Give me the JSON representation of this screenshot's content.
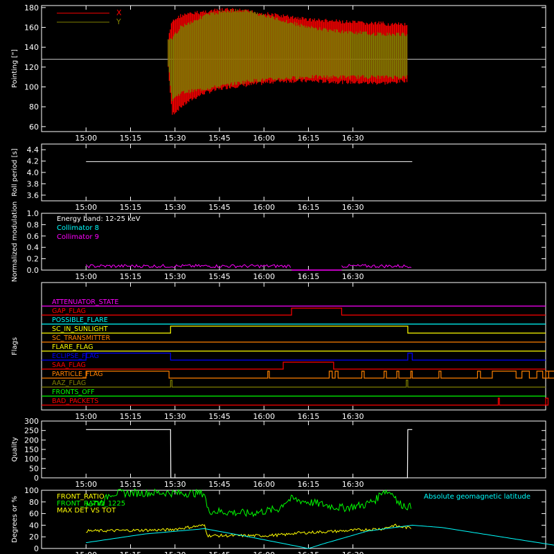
{
  "x_ticks": [
    "15:00",
    "15:15",
    "15:30",
    "15:45",
    "16:00",
    "16:15",
    "16:30"
  ],
  "colors": {
    "background": "#000000",
    "axes": "#ffffff",
    "x": "#ff0000",
    "y": "#808000",
    "cyan": "#00ffff",
    "magenta": "#ff00ff",
    "yellow": "#ffff00",
    "green": "#00ff00",
    "orange": "#ff8000",
    "blue": "#0000ff"
  },
  "chart_data": [
    {
      "type": "line",
      "ylabel": "Pointing [\"]",
      "ylim": [
        55,
        182
      ],
      "yticks": [
        60,
        80,
        100,
        120,
        140,
        160,
        180
      ],
      "xlim_min": [
        0,
        110
      ],
      "legend_position": "top-left",
      "reference_line": 128,
      "series": [
        {
          "name": "X",
          "color": "#ff0000",
          "t": [
            27.7,
            29,
            32,
            36,
            40,
            48,
            55,
            65,
            75,
            85,
            95,
            100,
            103,
            108.5
          ],
          "upper": [
            150,
            168,
            174,
            176,
            178,
            180,
            178,
            174,
            170,
            168,
            166,
            166,
            165,
            165
          ],
          "lower": [
            118,
            70,
            78,
            86,
            92,
            98,
            100,
            104,
            104,
            103,
            102,
            102,
            102,
            105
          ]
        },
        {
          "name": "Y",
          "color": "#808000",
          "t": [
            27.7,
            29,
            32,
            36,
            40,
            48,
            55,
            65,
            75,
            85,
            95,
            100,
            103,
            108.5
          ],
          "upper": [
            148,
            150,
            163,
            168,
            174,
            179,
            178,
            170,
            162,
            158,
            156,
            155,
            155,
            155
          ],
          "lower": [
            120,
            85,
            92,
            94,
            96,
            100,
            104,
            106,
            108,
            108,
            108,
            108,
            108,
            108
          ]
        }
      ]
    },
    {
      "type": "line",
      "ylabel": "Roll period [s]",
      "ylim": [
        3.5,
        4.5
      ],
      "yticks": [
        3.6,
        3.8,
        4.0,
        4.2,
        4.4
      ],
      "ytick_labels": [
        "3.6",
        "3.8",
        "4.0",
        "4.2",
        "4.4"
      ],
      "series": [
        {
          "name": "",
          "color": "#ffffff",
          "t": [
            0,
            110
          ],
          "values": [
            4.19,
            4.19
          ]
        }
      ]
    },
    {
      "type": "line",
      "ylabel": "Normalized modulation",
      "ylim": [
        0,
        1
      ],
      "yticks": [
        0,
        0.2,
        0.4,
        0.6,
        0.8,
        1.0
      ],
      "ytick_labels": [
        "0.0",
        "0.2",
        "0.4",
        "0.6",
        "0.8",
        "1.0"
      ],
      "legend": [
        "Energy band: 12-25 keV",
        "Collimator 8",
        "Collimator 9"
      ],
      "legend_colors": [
        "#ffffff",
        "#00ffff",
        "#ff00ff"
      ],
      "series": [
        {
          "name": "Collimator 9",
          "color": "#ff00ff",
          "segments": [
            [
              0,
              69.3,
              0.07
            ],
            [
              86.2,
              110,
              0.07
            ]
          ],
          "gap_value": 0.0
        }
      ]
    },
    {
      "type": "flags",
      "ylabel": "Flags",
      "flags": [
        {
          "name": "ATTENUATOR_STATE",
          "color": "#ff00ff",
          "steps": []
        },
        {
          "name": "GAP_FLAG",
          "color": "#ff0000",
          "steps": [
            [
              69.3,
              86.2
            ]
          ]
        },
        {
          "name": "POSSIBLE_FLARE",
          "color": "#00ffff",
          "steps": []
        },
        {
          "name": "SC_IN_SUNLIGHT",
          "color": "#ffff00",
          "steps": [
            [
              28.5,
              108.5
            ]
          ]
        },
        {
          "name": "SC_TRANSMITTER",
          "color": "#ff8000",
          "steps": []
        },
        {
          "name": "FLARE_FLAG",
          "color": "#ffff00",
          "steps": []
        },
        {
          "name": "ECLIPSE_FLAG",
          "color": "#0000ff",
          "steps": [
            [
              0,
              28.5
            ],
            [
              108.5,
              110
            ]
          ]
        },
        {
          "name": "SAA_FLAG",
          "color": "#ff0000",
          "steps": [
            [
              66.5,
              83.5
            ]
          ]
        },
        {
          "name": "PARTICLE_FLAG",
          "color": "#ff8000",
          "steps": [
            [
              0,
              28
            ],
            [
              61.3,
              61.8
            ],
            [
              82,
              83
            ],
            [
              84,
              85
            ],
            [
              93,
              93.8
            ],
            [
              100.5,
              101.3
            ],
            [
              104.8,
              105.5
            ],
            [
              109.5,
              110
            ],
            [
              119,
              119.7
            ],
            [
              132,
              133
            ],
            [
              137,
              145
            ],
            [
              147,
              149.5
            ],
            [
              152,
              154
            ],
            [
              156,
              158
            ],
            [
              160,
              162
            ],
            [
              165,
              167
            ]
          ]
        },
        {
          "name": "AAZ_FLAG",
          "color": "#808000",
          "steps": [
            [
              28.5,
              29
            ],
            [
              108,
              108.5
            ]
          ]
        },
        {
          "name": "FRONTS_OFF",
          "color": "#00ff00",
          "steps": []
        },
        {
          "name": "BAD_PACKETS",
          "color": "#ff0000",
          "steps": [
            [
              139,
              139.4
            ],
            [
              155.8,
              156.2
            ]
          ]
        }
      ]
    },
    {
      "type": "line",
      "ylabel": "Quality",
      "ylim": [
        0,
        300
      ],
      "yticks": [
        0,
        50,
        100,
        150,
        200,
        250,
        300
      ],
      "series": [
        {
          "name": "",
          "color": "#ffffff",
          "t": [
            0,
            28.5,
            28.6,
            108.4,
            108.5,
            110
          ],
          "values": [
            255,
            255,
            0,
            0,
            255,
            255
          ]
        }
      ]
    },
    {
      "type": "line",
      "ylabel": "Degrees or %",
      "ylim": [
        0,
        100
      ],
      "yticks": [
        0,
        20,
        40,
        60,
        80,
        100
      ],
      "legend": [
        "FRONT_RATIO",
        "FRONT_RATIO_1225",
        "MAX DET VS TOT",
        "Absolute geomagnetic latitude"
      ],
      "legend_colors": [
        "#ffff00",
        "#00ff00",
        "#ffff00",
        "#00ffff"
      ],
      "series": [
        {
          "name": "FRONT_RATIO_1225",
          "color": "#00ff00",
          "t": [
            0,
            2,
            6,
            8,
            28,
            30,
            40,
            41,
            55,
            65,
            67,
            69.3,
            86,
            87,
            94,
            98,
            100,
            104,
            105,
            110
          ],
          "values": [
            72,
            78,
            80,
            95,
            96,
            95,
            95,
            65,
            60,
            68,
            80,
            85,
            70,
            70,
            75,
            85,
            100,
            94,
            78,
            70
          ]
        },
        {
          "name": "FRONT_RATIO",
          "color": "#ffff00",
          "t": [
            0,
            28,
            40,
            41,
            60,
            68,
            69.3,
            86,
            100,
            104,
            105,
            110
          ],
          "values": [
            30,
            32,
            40,
            22,
            22,
            24,
            26,
            30,
            34,
            40,
            38,
            35
          ]
        },
        {
          "name": "Absolute geomagnetic latitude",
          "color": "#00ffff",
          "t": [
            0,
            20,
            40,
            55,
            75,
            80,
            95,
            110,
            120,
            140,
            165
          ],
          "values": [
            10,
            25,
            34,
            20,
            0,
            8,
            30,
            40,
            36,
            20,
            0
          ]
        }
      ]
    }
  ]
}
